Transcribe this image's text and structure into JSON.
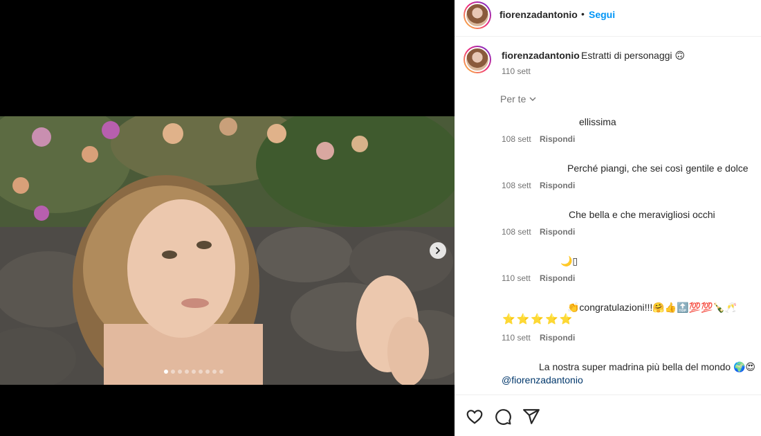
{
  "post": {
    "author": "fiorenzadantonio",
    "separator": "•",
    "follow_label": "Segui",
    "caption_text": "Estratti di personaggi 🙃",
    "caption_time": "110 sett"
  },
  "media": {
    "image_count": 9,
    "active_index": 0,
    "next_icon": "chevron-right-icon"
  },
  "comments_sort": {
    "label": "Per te",
    "icon": "chevron-down-icon"
  },
  "comments": [
    {
      "text": "ellissima",
      "time": "108 sett",
      "reply": "Rispondi"
    },
    {
      "text": "Perché piangi, che sei così gentile e dolce",
      "time": "108 sett",
      "reply": "Rispondi"
    },
    {
      "text": "Che bella e che meravigliosi occhi",
      "time": "108 sett",
      "reply": "Rispondi"
    },
    {
      "text": "🌙▯",
      "time": "110 sett",
      "reply": "Rispondi"
    },
    {
      "text": "👏congratulazioni!!!🤗👍🔝💯💯🍾🥂",
      "extra": "⭐⭐⭐⭐⭐",
      "time": "110 sett",
      "reply": "Rispondi"
    },
    {
      "text": "La nostra super madrina più bella del mondo 🌍😍",
      "mention": "@fiorenzadantonio"
    }
  ],
  "actions": {
    "like_icon": "heart-icon",
    "comment_icon": "comment-icon",
    "share_icon": "send-icon"
  },
  "colors": {
    "follow": "#0095f6",
    "muted": "#737373",
    "text": "#262626",
    "mention": "#00376b"
  }
}
